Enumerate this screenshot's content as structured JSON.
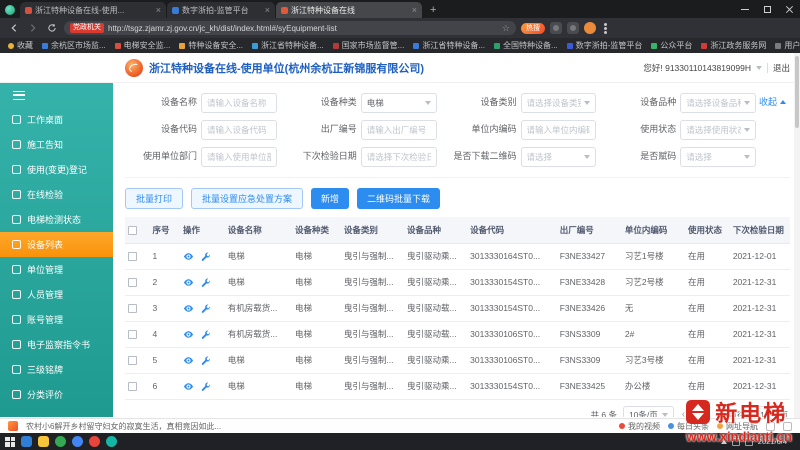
{
  "browser": {
    "tabs": [
      {
        "title": "浙江特种设备在线-使用..."
      },
      {
        "title": "数字浙拍-监管平台"
      },
      {
        "title": "浙江特种设备在线"
      }
    ],
    "url_badge": "党政机关",
    "url": "http://tsgz.zjamr.zj.gov.cn/jc_kh/dist/index.html#/syEquipment-list",
    "hot_label": "热搜",
    "bookmarks": [
      "收藏",
      "余杭区市场监...",
      "电梯安全监...",
      "特种设备安全...",
      "浙江省特种设备...",
      "国家市场监督管...",
      "浙江省特种设备...",
      "全国特种设备...",
      "数字浙拍-监管平台",
      "公众平台",
      "浙江政务服务网",
      "用户中心-工作台..."
    ]
  },
  "header": {
    "title": "浙江特种设备在线-使用单位(杭州余杭正新锦服有限公司)",
    "greeting": "您好! 91330110143819099H",
    "logout": "退出"
  },
  "sidebar": {
    "items": [
      {
        "label": "工作桌面"
      },
      {
        "label": "施工告知"
      },
      {
        "label": "使用(变更)登记"
      },
      {
        "label": "在线检验"
      },
      {
        "label": "电梯检测状态"
      },
      {
        "label": "设备列表"
      },
      {
        "label": "单位管理"
      },
      {
        "label": "人员管理"
      },
      {
        "label": "账号管理"
      },
      {
        "label": "电子监察指令书"
      },
      {
        "label": "三级铭牌"
      },
      {
        "label": "分类评价"
      }
    ]
  },
  "filters": {
    "collapse": "收起",
    "fields": [
      {
        "label": "设备名称",
        "placeholder": "请输入设备名称"
      },
      {
        "label": "设备种类",
        "value": "电梯"
      },
      {
        "label": "设备类别",
        "value": "请选择设备类别"
      },
      {
        "label": "设备品种",
        "value": "请选择设备品种"
      },
      {
        "label": "设备代码",
        "placeholder": "请输入设备代码"
      },
      {
        "label": "出厂编号",
        "placeholder": "请输入出厂编号"
      },
      {
        "label": "单位内编码",
        "placeholder": "请输入单位内编码"
      },
      {
        "label": "使用状态",
        "value": "请选择使用状态"
      },
      {
        "label": "使用单位部门",
        "placeholder": "请输入使用单位部门"
      },
      {
        "label": "下次检验日期",
        "placeholder": "请选择下次检验日期"
      },
      {
        "label": "是否下载二维码",
        "value": "请选择"
      },
      {
        "label": "是否赋码",
        "value": "请选择"
      }
    ]
  },
  "toolbar": {
    "batch_print": "批量打印",
    "batch_plan": "批量设置应急处置方案",
    "add": "新增",
    "qr_download": "二维码批量下载"
  },
  "table": {
    "columns": [
      "序号",
      "操作",
      "设备名称",
      "设备种类",
      "设备类别",
      "设备品种",
      "设备代码",
      "出厂编号",
      "单位内编码",
      "使用状态",
      "下次检验日期"
    ],
    "rows": [
      {
        "no": "1",
        "name": "电梯",
        "kind": "电梯",
        "category": "曳引与强制...",
        "variety": "曳引驱动乘...",
        "code": "3013330164ST0...",
        "factory_no": "F3NE33427",
        "unit_code": "习艺1号楼",
        "status": "在用",
        "next_date": "2021-12-01"
      },
      {
        "no": "2",
        "name": "电梯",
        "kind": "电梯",
        "category": "曳引与强制...",
        "variety": "曳引驱动乘...",
        "code": "3013330154ST0...",
        "factory_no": "F3NE33428",
        "unit_code": "习艺2号楼",
        "status": "在用",
        "next_date": "2021-12-31"
      },
      {
        "no": "3",
        "name": "有机房载货...",
        "kind": "电梯",
        "category": "曳引与强制...",
        "variety": "曳引驱动载...",
        "code": "3013330154ST0...",
        "factory_no": "F3NE33426",
        "unit_code": "无",
        "status": "在用",
        "next_date": "2021-12-31"
      },
      {
        "no": "4",
        "name": "有机房载货...",
        "kind": "电梯",
        "category": "曳引与强制...",
        "variety": "曳引驱动载...",
        "code": "3013330106ST0...",
        "factory_no": "F3NS3309",
        "unit_code": "2#",
        "status": "在用",
        "next_date": "2021-12-31"
      },
      {
        "no": "5",
        "name": "电梯",
        "kind": "电梯",
        "category": "曳引与强制...",
        "variety": "曳引驱动乘...",
        "code": "3013330106ST0...",
        "factory_no": "F3NS3309",
        "unit_code": "习艺3号楼",
        "status": "在用",
        "next_date": "2021-12-31"
      },
      {
        "no": "6",
        "name": "电梯",
        "kind": "电梯",
        "category": "曳引与强制...",
        "variety": "曳引驱动乘...",
        "code": "3013330154ST0...",
        "factory_no": "F3NE33425",
        "unit_code": "办公楼",
        "status": "在用",
        "next_date": "2021-12-31"
      }
    ]
  },
  "pagination": {
    "total": "共 6 条",
    "page_size": "10条/页",
    "current": "1",
    "goto_label": "前往",
    "goto_value": "1",
    "page_unit": "页"
  },
  "ticker": {
    "headline": "农村小6解开乡村留守妇女的寂寞生活，真相竟因如此...",
    "items": [
      "我的视频",
      "每日头条",
      "网址导航"
    ]
  },
  "taskbar": {
    "date": "2021/6/4"
  },
  "watermark": {
    "brand": "新电梯",
    "site": "www.xindianti.cn"
  }
}
